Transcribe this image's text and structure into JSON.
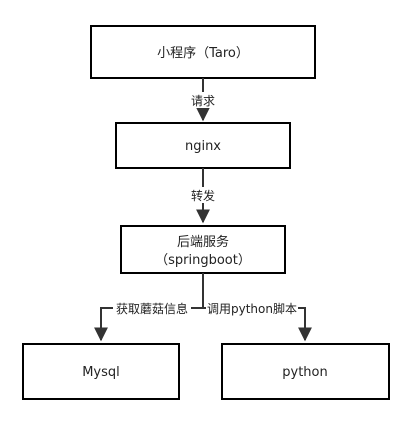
{
  "colors": {
    "background": "#ffffff",
    "stroke": "#000000",
    "text": "#222222"
  },
  "nodes": {
    "miniapp": {
      "label": "小程序（Taro）"
    },
    "nginx": {
      "label": "nginx"
    },
    "backend": {
      "line1": "后端服务",
      "line2": "（springboot）"
    },
    "mysql": {
      "label": "Mysql"
    },
    "python": {
      "label": "python"
    }
  },
  "edges": {
    "request": {
      "label": "请求"
    },
    "forward": {
      "label": "转发"
    },
    "fetch": {
      "label": "获取蘑菇信息"
    },
    "call": {
      "label": "调用python脚本"
    }
  }
}
